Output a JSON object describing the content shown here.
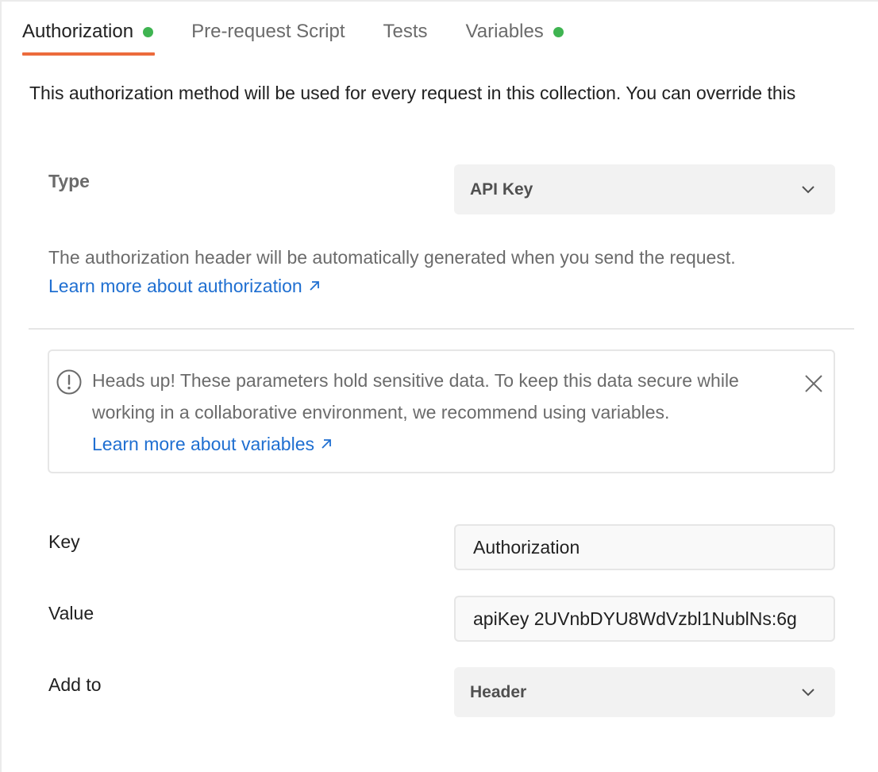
{
  "colors": {
    "accent": "#ec6b3c",
    "status_dot": "#3fb451",
    "link": "#1f6fd1"
  },
  "tabs": [
    {
      "label": "Authorization",
      "active": true,
      "has_dot": true
    },
    {
      "label": "Pre-request Script",
      "active": false,
      "has_dot": false
    },
    {
      "label": "Tests",
      "active": false,
      "has_dot": false
    },
    {
      "label": "Variables",
      "active": false,
      "has_dot": true
    }
  ],
  "description": "This authorization method will be used for every request in this collection. You can override this",
  "type": {
    "label": "Type",
    "selected": "API Key"
  },
  "helper": {
    "text": "The authorization header will be automatically generated when you send the request.",
    "link": "Learn more about authorization"
  },
  "alert": {
    "text": "Heads up! These parameters hold sensitive data. To keep this data secure while working in a collaborative environment, we recommend using variables.",
    "link": "Learn more about variables"
  },
  "fields": {
    "key": {
      "label": "Key",
      "value": "Authorization"
    },
    "value": {
      "label": "Value",
      "value": "apiKey 2UVnbDYU8WdVzbl1NublNs:6g"
    },
    "add_to": {
      "label": "Add to",
      "selected": "Header"
    }
  }
}
